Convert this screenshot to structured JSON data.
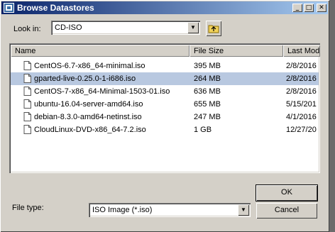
{
  "window": {
    "title": "Browse Datastores"
  },
  "look_in": {
    "label": "Look in:",
    "value": "CD-ISO"
  },
  "list": {
    "columns": [
      "Name",
      "File Size",
      "Last Mod"
    ],
    "rows": [
      {
        "name": "CentOS-6.7-x86_64-minimal.iso",
        "size": "395 MB",
        "modified": "2/8/2016"
      },
      {
        "name": "gparted-live-0.25.0-1-i686.iso",
        "size": "264 MB",
        "modified": "2/8/2016"
      },
      {
        "name": "CentOS-7-x86_64-Minimal-1503-01.iso",
        "size": "636 MB",
        "modified": "2/8/2016"
      },
      {
        "name": "ubuntu-16.04-server-amd64.iso",
        "size": "655 MB",
        "modified": "5/15/201"
      },
      {
        "name": "debian-8.3.0-amd64-netinst.iso",
        "size": "247 MB",
        "modified": "4/1/2016"
      },
      {
        "name": "CloudLinux-DVD-x86_64-7.2.iso",
        "size": "1 GB",
        "modified": "12/27/20"
      }
    ],
    "selected_row": "gparted-live-0.25.0-1-i686.iso"
  },
  "file_type": {
    "label": "File type:",
    "value": "ISO Image (*.iso)"
  },
  "buttons": {
    "ok": "OK",
    "cancel": "Cancel"
  },
  "colors": {
    "titlebar": "#0a246a",
    "selection": "#b8c8e0"
  }
}
